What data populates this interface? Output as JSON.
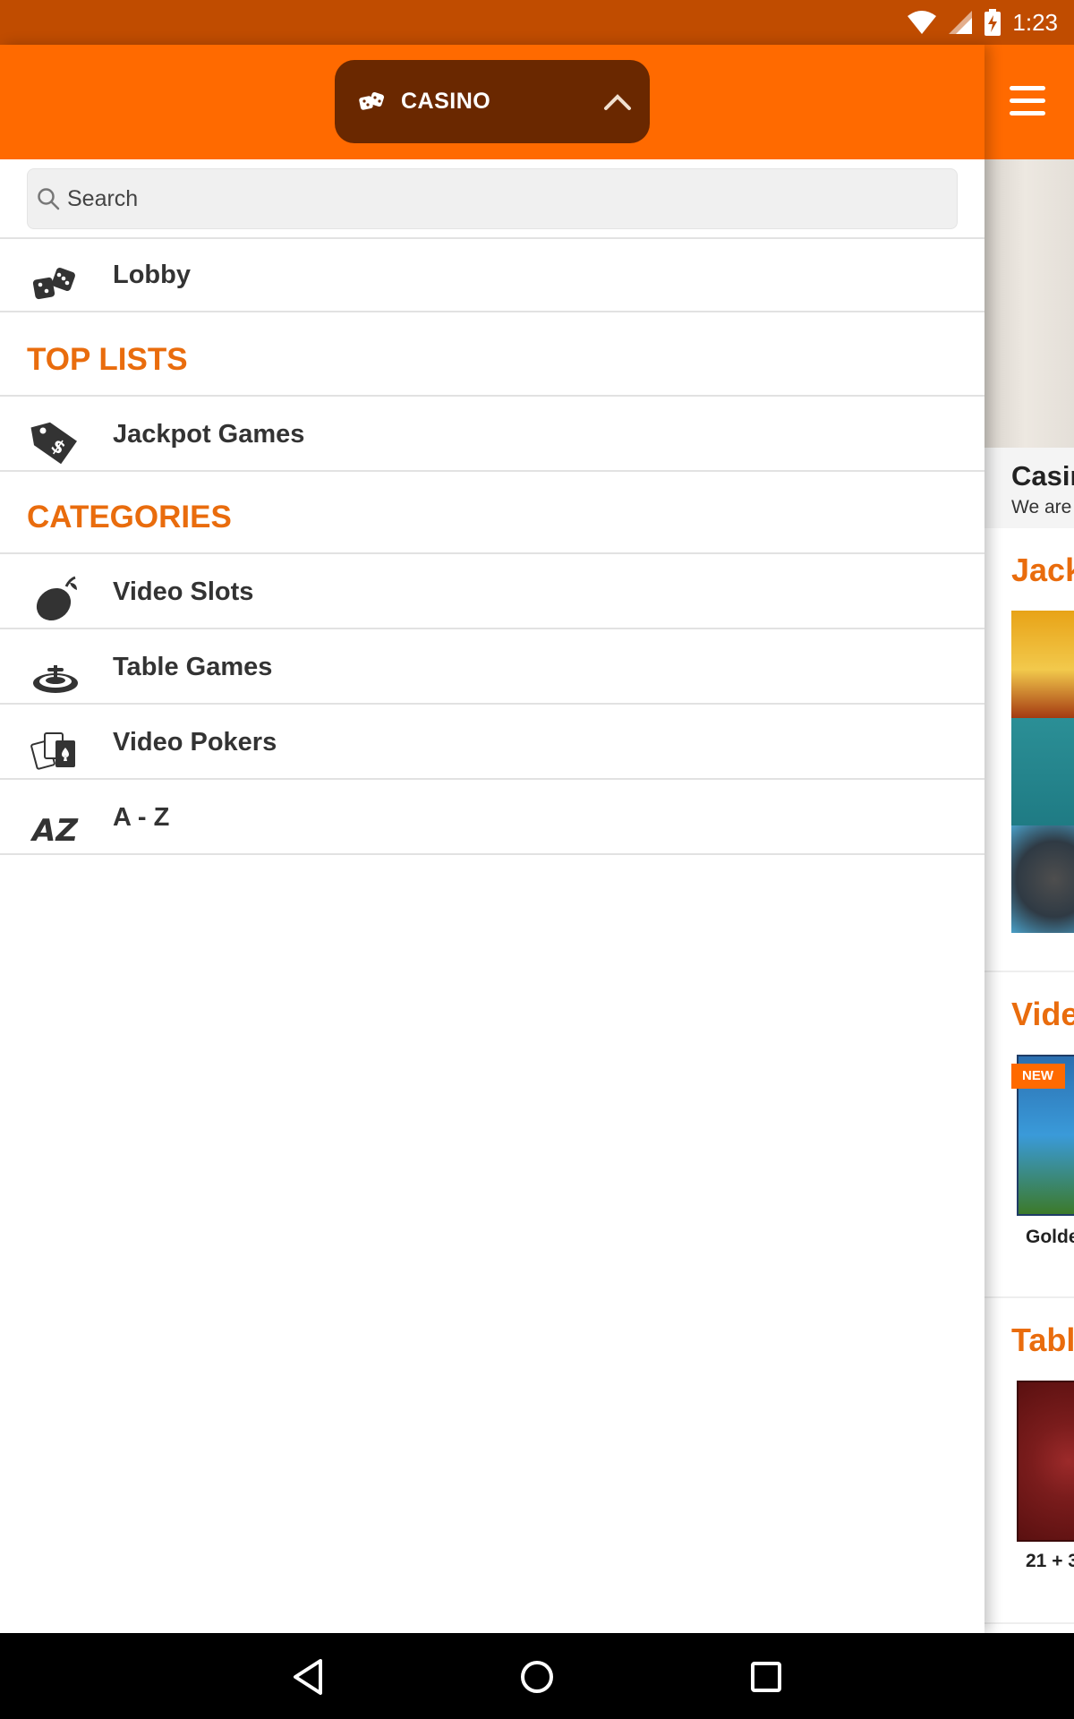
{
  "status_bar": {
    "time": "1:23",
    "icons": [
      "wifi-icon",
      "signal-icon",
      "battery-charging-icon"
    ]
  },
  "drawer": {
    "selector": {
      "label": "CASINO",
      "icon": "dice-icon",
      "arrow": "chevron-up-icon"
    },
    "search": {
      "placeholder": "Search",
      "value": ""
    },
    "lobby": {
      "label": "Lobby",
      "icon": "dice-icon"
    },
    "top_lists": {
      "heading": "TOP LISTS",
      "items": [
        {
          "label": "Jackpot Games",
          "icon": "price-tag-icon"
        }
      ]
    },
    "categories": {
      "heading": "CATEGORIES",
      "items": [
        {
          "label": "Video Slots",
          "icon": "lemon-icon"
        },
        {
          "label": "Table Games",
          "icon": "roulette-icon"
        },
        {
          "label": "Video Pokers",
          "icon": "playing-cards-icon"
        },
        {
          "label": "A - Z",
          "icon": "az-icon"
        }
      ]
    }
  },
  "background_page": {
    "menu_icon": "hamburger-icon",
    "hero_title": "Casir",
    "hero_subtitle": "We are",
    "sections": [
      {
        "title": "Jack"
      },
      {
        "title": "Vide",
        "badge": "NEW",
        "tile_label": "Golde"
      },
      {
        "title": "Tabl",
        "tile_label": "21 + 3"
      }
    ]
  },
  "nav_bar": {
    "buttons": [
      "back-icon",
      "home-icon",
      "recents-icon"
    ]
  },
  "colors": {
    "status_bar": "#c04c00",
    "header": "#ff6a00",
    "selector": "#6a2800",
    "accent_text": "#e96c0d"
  }
}
